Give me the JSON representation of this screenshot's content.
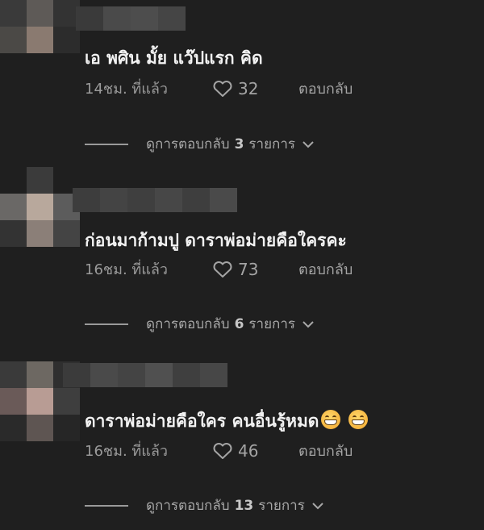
{
  "comments": [
    {
      "text": "เอ พศิน มั้ย แว๊ปแรก คิด",
      "time": "14ชม. ที่แล้ว",
      "likes": "32",
      "reply_label": "ตอบกลับ",
      "view_replies_prefix": "ดูการตอบกลับ",
      "reply_count": "3",
      "view_replies_suffix": "รายการ"
    },
    {
      "text": "ก่อนมาก้ามปู ดาราพ่อม่ายคือใครคะ",
      "time": "16ชม. ที่แล้ว",
      "likes": "73",
      "reply_label": "ตอบกลับ",
      "view_replies_prefix": "ดูการตอบกลับ",
      "reply_count": "6",
      "view_replies_suffix": "รายการ"
    },
    {
      "text": "ดาราพ่อม่ายคือใคร คนอื่นรู้หมด",
      "emojis": [
        "grinning-face-emoji",
        "grinning-face-emoji"
      ],
      "time": "16ชม. ที่แล้ว",
      "likes": "46",
      "reply_label": "ตอบกลับ",
      "view_replies_prefix": "ดูการตอบกลับ",
      "reply_count": "13",
      "view_replies_suffix": "รายการ"
    }
  ],
  "icons": {
    "like": "heart-outline-icon",
    "expand": "chevron-down-icon"
  },
  "colors": {
    "background": "#1f1f1f",
    "text": "#f2f2f2",
    "meta": "#9a9a9a"
  }
}
